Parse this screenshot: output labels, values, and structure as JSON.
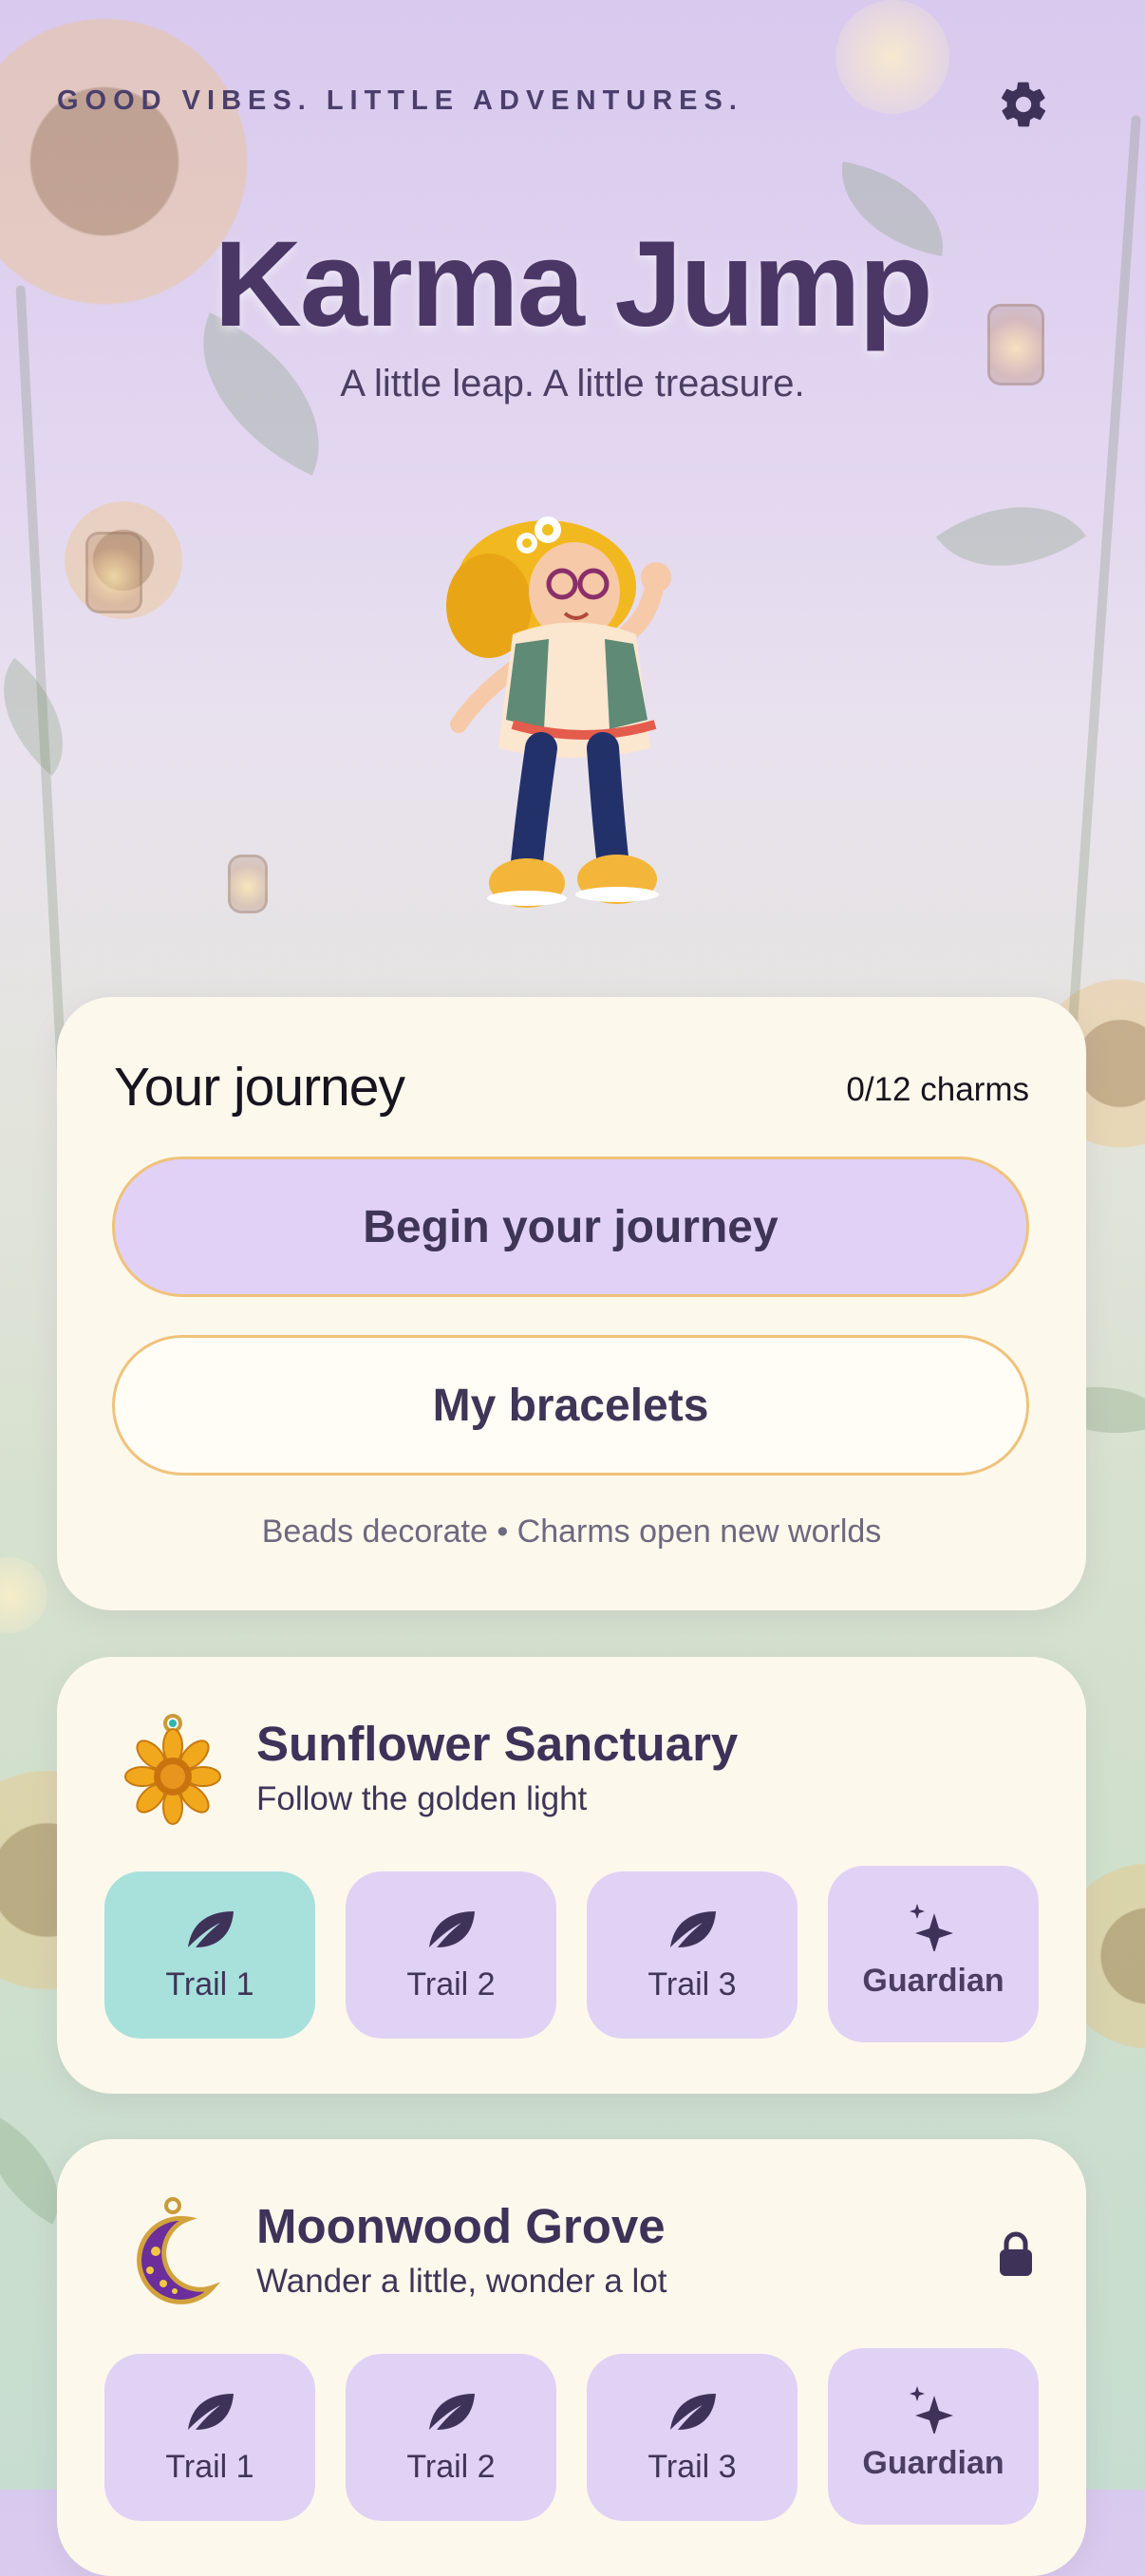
{
  "header": {
    "tagline": "GOOD VIBES. LITTLE ADVENTURES.",
    "settings_icon": "gear-icon"
  },
  "hero": {
    "title": "Karma Jump",
    "subtitle": "A little leap. A little treasure."
  },
  "journey": {
    "title": "Your journey",
    "charm_count": "0/12 charms",
    "primary_button": "Begin your journey",
    "secondary_button": "My bracelets",
    "hint": "Beads decorate • Charms open new worlds"
  },
  "worlds": [
    {
      "name": "Sunflower Sanctuary",
      "subtitle": "Follow the golden light",
      "icon": "sunflower-charm-icon",
      "locked": false,
      "trails": [
        {
          "label": "Trail 1",
          "icon": "leaf-icon",
          "active": true
        },
        {
          "label": "Trail 2",
          "icon": "leaf-icon",
          "active": false
        },
        {
          "label": "Trail 3",
          "icon": "leaf-icon",
          "active": false
        },
        {
          "label": "Guardian",
          "icon": "sparkle-icon",
          "active": false
        }
      ]
    },
    {
      "name": "Moonwood Grove",
      "subtitle": "Wander a little, wonder a lot",
      "icon": "crescent-moon-charm-icon",
      "locked": true,
      "trails": [
        {
          "label": "Trail 1",
          "icon": "leaf-icon",
          "active": false
        },
        {
          "label": "Trail 2",
          "icon": "leaf-icon",
          "active": false
        },
        {
          "label": "Trail 3",
          "icon": "leaf-icon",
          "active": false
        },
        {
          "label": "Guardian",
          "icon": "sparkle-icon",
          "active": false
        }
      ]
    }
  ],
  "colors": {
    "accent_purple": "#e1d1f6",
    "active_teal": "#a8e0dc",
    "card_cream": "#fdf8ec",
    "button_border": "#f0c27b",
    "title_purple": "#4a3766"
  }
}
